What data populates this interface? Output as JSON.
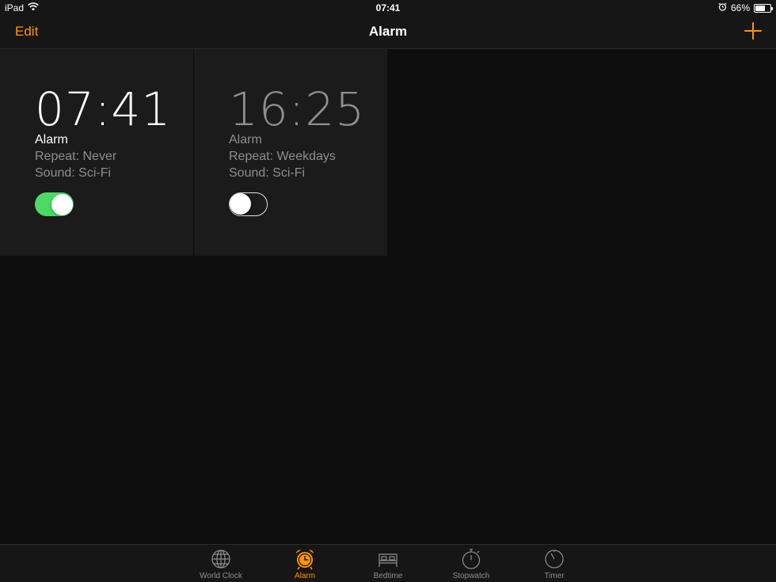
{
  "status_bar": {
    "device": "iPad",
    "time": "07:41",
    "battery": "66%",
    "battery_level": 0.66,
    "icons": [
      "wifi-icon",
      "alarm-clock-icon",
      "battery-icon"
    ]
  },
  "nav": {
    "edit_label": "Edit",
    "title": "Alarm",
    "add_icon": "plus-icon"
  },
  "alarms": [
    {
      "time": "07:41",
      "label": "Alarm",
      "repeat": "Repeat: Never",
      "sound": "Sound: Sci-Fi",
      "enabled": true
    },
    {
      "time": "16:25",
      "label": "Alarm",
      "repeat": "Repeat: Weekdays",
      "sound": "Sound: Sci-Fi",
      "enabled": false
    }
  ],
  "tabs": [
    {
      "label": "World Clock",
      "icon": "globe-icon",
      "active": false
    },
    {
      "label": "Alarm",
      "icon": "alarm-clock-icon",
      "active": true
    },
    {
      "label": "Bedtime",
      "icon": "bed-icon",
      "active": false
    },
    {
      "label": "Stopwatch",
      "icon": "stopwatch-icon",
      "active": false
    },
    {
      "label": "Timer",
      "icon": "timer-icon",
      "active": false
    }
  ],
  "colors": {
    "accent": "#ff9500",
    "toggle_on": "#4cd964",
    "background": "#0e0e0e",
    "card": "#1b1b1b",
    "secondary_text": "#8e8e93"
  }
}
